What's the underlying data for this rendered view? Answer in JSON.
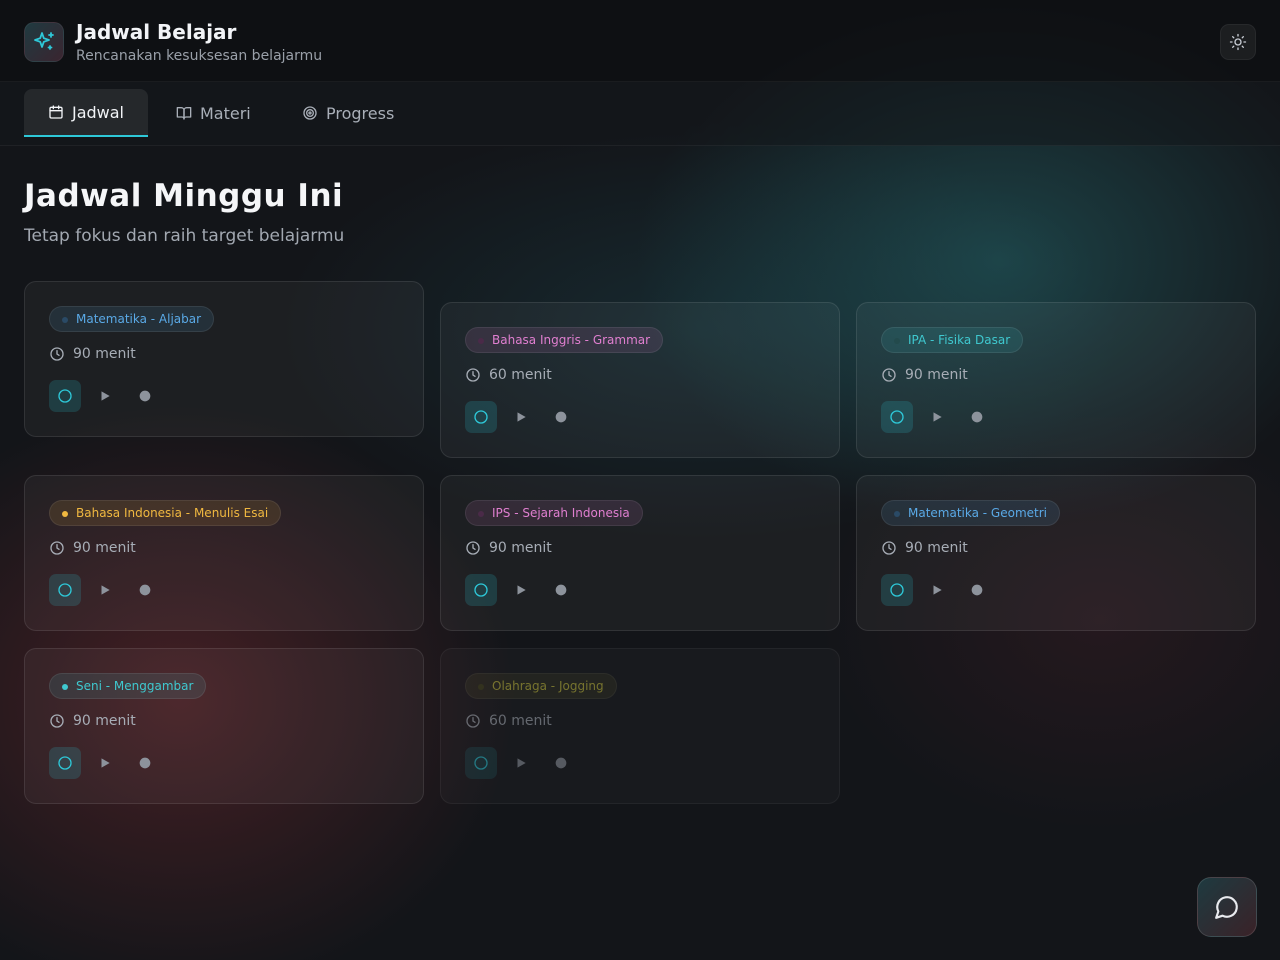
{
  "header": {
    "title": "Jadwal Belajar",
    "subtitle": "Rencanakan kesuksesan belajarmu"
  },
  "tabs": [
    {
      "label": "Jadwal",
      "icon": "calendar-icon",
      "active": true
    },
    {
      "label": "Materi",
      "icon": "book-open-icon",
      "active": false
    },
    {
      "label": "Progress",
      "icon": "target-icon",
      "active": false
    }
  ],
  "main": {
    "title": "Jadwal Minggu Ini",
    "subtitle": "Tetap fokus dan raih target belajarmu"
  },
  "colors": {
    "accent": "#2ec8d8",
    "background": "#131519"
  },
  "cards": [
    {
      "subject": "Matematika - Aljabar",
      "duration": "90 menit",
      "chip_color": "#5aa9e6",
      "dot_color": "#2a4a66"
    },
    {
      "subject": "Bahasa Inggris - Grammar",
      "duration": "60 menit",
      "chip_color": "#e07fd0",
      "dot_color": "#4a2a48"
    },
    {
      "subject": "IPA - Fisika Dasar",
      "duration": "90 menit",
      "chip_color": "#3fc8cf",
      "dot_color": "#234a4c"
    },
    {
      "subject": "Bahasa Indonesia - Menulis Esai",
      "duration": "90 menit",
      "chip_color": "#f0b840",
      "dot_color": "#f0b840"
    },
    {
      "subject": "IPS - Sejarah Indonesia",
      "duration": "90 menit",
      "chip_color": "#e07fd0",
      "dot_color": "#4a2a48"
    },
    {
      "subject": "Matematika - Geometri",
      "duration": "90 menit",
      "chip_color": "#5aa9e6",
      "dot_color": "#2a4a66"
    },
    {
      "subject": "Seni - Menggambar",
      "duration": "90 menit",
      "chip_color": "#3fc8cf",
      "dot_color": "#3fc8cf"
    },
    {
      "subject": "Olahraga - Jogging",
      "duration": "60 menit",
      "chip_color": "#c8c040",
      "dot_color": "#4a4a22"
    }
  ]
}
